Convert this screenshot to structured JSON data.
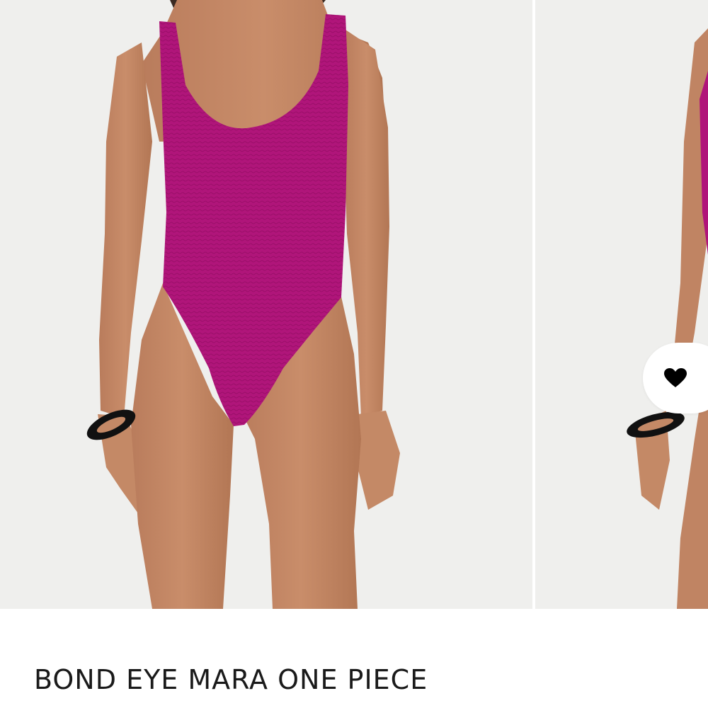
{
  "product": {
    "title": "BOND EYE MARA ONE PIECE"
  },
  "gallery": {
    "images": [
      {
        "subject": "model wearing magenta textured scoop-neck one piece swimsuit, front view"
      },
      {
        "subject": "partial view of second product image"
      }
    ]
  },
  "wishlist": {
    "icon": "heart-icon"
  },
  "colors": {
    "swimsuit": "#b0157a",
    "background": "#efefed",
    "text": "#1a1a1a"
  }
}
